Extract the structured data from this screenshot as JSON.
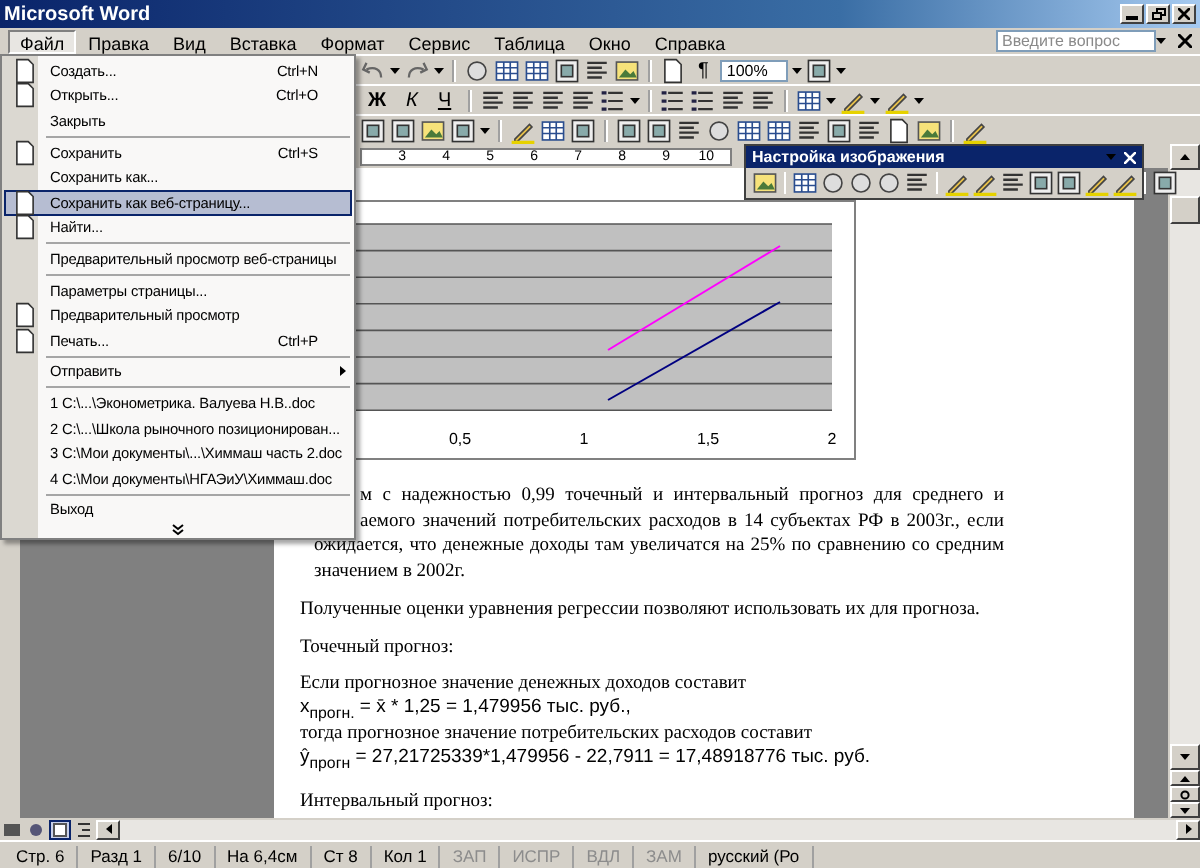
{
  "window": {
    "title": "Microsoft Word"
  },
  "menubar": {
    "items": [
      {
        "label": "Файл",
        "selected": true
      },
      {
        "label": "Правка",
        "selected": false
      },
      {
        "label": "Вид",
        "selected": false
      },
      {
        "label": "Вставка",
        "selected": false
      },
      {
        "label": "Формат",
        "selected": false
      },
      {
        "label": "Сервис",
        "selected": false
      },
      {
        "label": "Таблица",
        "selected": false
      },
      {
        "label": "Окно",
        "selected": false
      },
      {
        "label": "Справка",
        "selected": false
      }
    ],
    "help_search": {
      "placeholder": "Введите вопрос"
    }
  },
  "file_menu": {
    "sections": [
      [
        {
          "label": "Создать...",
          "shortcut": "Ctrl+N",
          "has_icon": true,
          "selected": false,
          "submenu": false
        },
        {
          "label": "Открыть...",
          "shortcut": "Ctrl+O",
          "has_icon": true,
          "selected": false,
          "submenu": false
        },
        {
          "label": "Закрыть",
          "has_icon": false,
          "selected": false,
          "submenu": false
        }
      ],
      [
        {
          "label": "Сохранить",
          "shortcut": "Ctrl+S",
          "has_icon": true,
          "selected": false,
          "submenu": false
        },
        {
          "label": "Сохранить как...",
          "has_icon": false,
          "selected": false,
          "submenu": false
        },
        {
          "label": "Сохранить как веб-страницу...",
          "has_icon": true,
          "selected": true,
          "submenu": false
        },
        {
          "label": "Найти...",
          "has_icon": true,
          "selected": false,
          "submenu": false
        }
      ],
      [
        {
          "label": "Предварительный просмотр веб-страницы",
          "has_icon": false,
          "selected": false,
          "submenu": false
        }
      ],
      [
        {
          "label": "Параметры страницы...",
          "has_icon": false,
          "selected": false,
          "submenu": false
        },
        {
          "label": "Предварительный просмотр",
          "has_icon": true,
          "selected": false,
          "submenu": false
        },
        {
          "label": "Печать...",
          "shortcut": "Ctrl+P",
          "has_icon": true,
          "selected": false,
          "submenu": false
        }
      ],
      [
        {
          "label": "Отправить",
          "has_icon": false,
          "selected": false,
          "submenu": true
        }
      ],
      [
        {
          "label": "1 C:\\...\\Эконометрика. Валуева Н.В..doc",
          "has_icon": false,
          "selected": false,
          "submenu": false
        },
        {
          "label": "2 C:\\...\\Школа рыночного позиционирован...",
          "has_icon": false,
          "selected": false,
          "submenu": false
        },
        {
          "label": "3 C:\\Мои документы\\...\\Химмаш часть 2.doc",
          "has_icon": false,
          "selected": false,
          "submenu": false
        },
        {
          "label": "4 C:\\Мои документы\\НГАЭиУ\\Химмаш.doc",
          "has_icon": false,
          "selected": false,
          "submenu": false
        }
      ],
      [
        {
          "label": "Выход",
          "has_icon": false,
          "selected": false,
          "submenu": false
        }
      ]
    ]
  },
  "toolbars": {
    "standard": {
      "paragraph_mark": "¶",
      "zoom": "100%"
    },
    "formatting": {
      "bold": "Ж",
      "italic": "К",
      "underline": "Ч"
    }
  },
  "ruler": {
    "labels": [
      "3",
      "4",
      "5",
      "6",
      "7",
      "8",
      "9",
      "10"
    ]
  },
  "picture_toolbar": {
    "title": "Настройка изображения"
  },
  "document": {
    "chart": {
      "x_tick_labels": [
        "0,5",
        "1",
        "1,5",
        "2"
      ]
    },
    "paragraphs": [
      {
        "kind": "task",
        "covered_lines": [
          "м с надежностью 0,99 точечный и интервальный прогноз для среднего и",
          "аемого значений потребительских расходов в 14 субъектах РФ в 2003г., если"
        ],
        "lines": [
          "ожидается, что денежные доходы там увеличатся на 25% по сравнению со средним",
          "значением в 2002г."
        ]
      },
      {
        "kind": "text",
        "text": "Полученные оценки уравнения регрессии позволяют использовать их для прогноза."
      },
      {
        "kind": "text",
        "text": "Точечный прогноз:"
      },
      {
        "kind": "formula_block",
        "lines": [
          {
            "kind": "text",
            "text": "Если прогнозное значение денежных доходов составит"
          },
          {
            "kind": "formula",
            "text": "x$_{прогн.}$ = x̄ * 1,25 = 1,479956 тыс. руб.,"
          },
          {
            "kind": "text",
            "text": "тогда прогнозное значение потребительских расходов составит"
          },
          {
            "kind": "formula",
            "text": "ŷ$_{прогн}$ = 27,21725339*1,479956 - 22,7911 = 17,48918776 тыс. руб."
          }
        ]
      },
      {
        "kind": "text",
        "text": "Интервальный прогноз:"
      }
    ]
  },
  "status_bar": [
    {
      "text": "Стр. 6",
      "disabled": false
    },
    {
      "text": "Разд 1",
      "disabled": false
    },
    {
      "text": "6/10",
      "disabled": false
    },
    {
      "text": "На 6,4см",
      "disabled": false
    },
    {
      "text": "Ст 8",
      "disabled": false
    },
    {
      "text": "Кол 1",
      "disabled": false
    },
    {
      "text": "ЗАП",
      "disabled": true
    },
    {
      "text": "ИСПР",
      "disabled": true
    },
    {
      "text": "ВДЛ",
      "disabled": true
    },
    {
      "text": "ЗАМ",
      "disabled": true
    },
    {
      "text": "русский (Ро",
      "disabled": false
    }
  ]
}
